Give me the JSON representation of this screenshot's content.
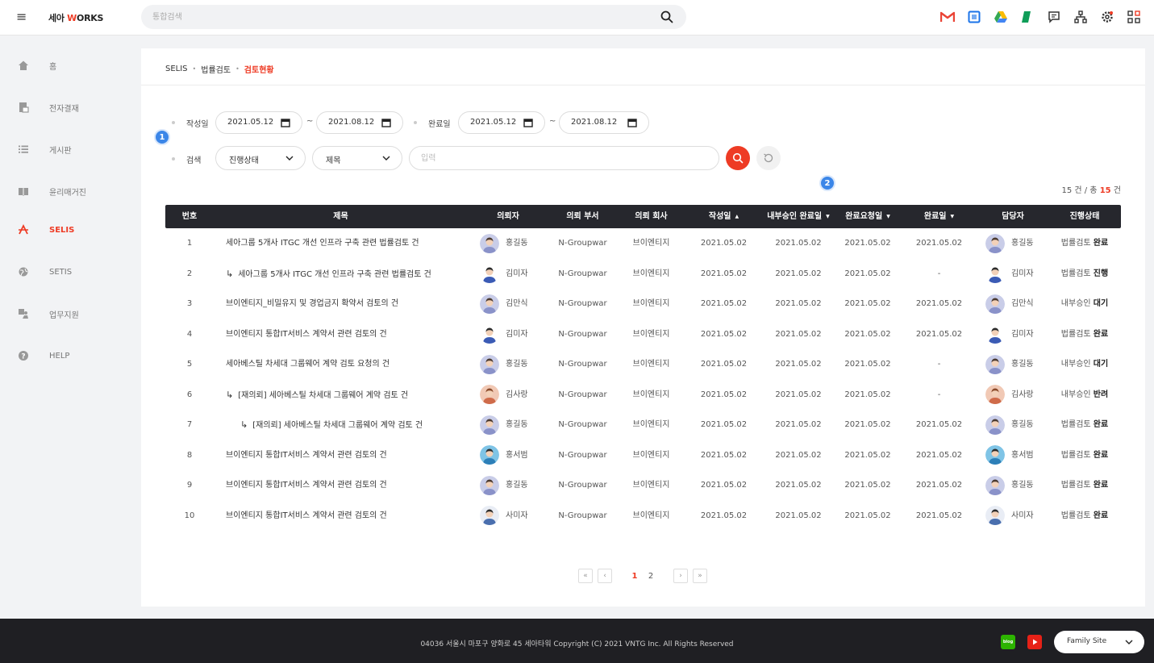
{
  "topbar": {
    "logo_prefix": "세아 ",
    "logo_w": "W",
    "logo_suffix": "ORKS",
    "search_placeholder": "통합검색",
    "apps": [
      {
        "icon": "gmail-icon",
        "color": "#ea4335"
      },
      {
        "icon": "calendar-icon",
        "color": "#1a73e8"
      },
      {
        "icon": "drive-icon",
        "color": "#34a853"
      },
      {
        "icon": "sheets-icon",
        "color": "#0f9d58"
      },
      {
        "icon": "chat-icon",
        "color": "#333333"
      },
      {
        "icon": "org-chart-icon",
        "color": "#333333"
      },
      {
        "icon": "settings-icon",
        "color": "#333333"
      },
      {
        "icon": "apps-grid-icon",
        "color": "#333333"
      }
    ]
  },
  "sidebar": {
    "items": [
      {
        "label": "홈",
        "icon": "home-icon",
        "active": false
      },
      {
        "label": "전자결재",
        "icon": "approval-icon",
        "active": false
      },
      {
        "label": "게시판",
        "icon": "board-icon",
        "active": false
      },
      {
        "label": "윤리매거진",
        "icon": "magazine-icon",
        "active": false
      },
      {
        "label": "SELIS",
        "icon": "selis-icon",
        "active": true
      },
      {
        "label": "SETIS",
        "icon": "globe-icon",
        "active": false
      },
      {
        "label": "업무지원",
        "icon": "support-icon",
        "active": false
      },
      {
        "label": "HELP",
        "icon": "help-icon",
        "active": false
      }
    ]
  },
  "breadcrumb": {
    "items": [
      "SELIS",
      "법률검토"
    ],
    "current": "검토현황",
    "separator": "•"
  },
  "filters": {
    "created_label": "작성일",
    "created_from": "2021.05.12",
    "created_to": "2021.08.12",
    "tilde": "~",
    "completed_label": "완료일",
    "completed_from": "2021.05.12",
    "completed_to": "2021.08.12",
    "search_label": "검색",
    "status_select": "진행상태",
    "field_select": "제목",
    "input_placeholder": "입력",
    "badge1": "1",
    "badge2": "2"
  },
  "count": {
    "shown": "15 건",
    "sep": " / 총 ",
    "total": "15",
    "unit": " 건"
  },
  "table": {
    "columns": [
      "번호",
      "제목",
      "의뢰자",
      "의뢰 부서",
      "의뢰 회사",
      "작성일",
      "내부승인 완료일",
      "완료요청일",
      "완료일",
      "담당자",
      "진행상태"
    ],
    "sort_up": "▲",
    "sort_down": "▼",
    "reply_icon": "↳",
    "rows": [
      {
        "no": "1",
        "title": "세아그룹 5개사 ITGC 개선 인프라 구축 관련 법률검토 건",
        "indent": 0,
        "requester": "홍길동",
        "avatar": "male",
        "dept": "N-Groupwar",
        "company": "브이엔티지",
        "created": "2021.05.02",
        "approved": "2021.05.02",
        "requested": "2021.05.02",
        "completed": "2021.05.02",
        "manager": "홍길동",
        "status_prefix": "법률검토 ",
        "status": "완료"
      },
      {
        "no": "2",
        "title": "세아그룹 5개사 ITGC 개선 인프라 구축 관련 법률검토 건",
        "indent": 1,
        "requester": "김미자",
        "avatar": "female",
        "dept": "N-Groupwar",
        "company": "브이엔티지",
        "created": "2021.05.02",
        "approved": "2021.05.02",
        "requested": "2021.05.02",
        "completed": "-",
        "manager": "김미자",
        "status_prefix": "법률검토 ",
        "status": "진행"
      },
      {
        "no": "3",
        "title": "브이엔티지_비밀유지 및 경업금지 확약서 검토의 건",
        "indent": 0,
        "requester": "김만식",
        "avatar": "male",
        "dept": "N-Groupwar",
        "company": "브이엔티지",
        "created": "2021.05.02",
        "approved": "2021.05.02",
        "requested": "2021.05.02",
        "completed": "2021.05.02",
        "manager": "김만식",
        "status_prefix": "내부승인 ",
        "status": "대기"
      },
      {
        "no": "4",
        "title": "브이엔티지 통합IT서비스 계약서 관련 검토의 건",
        "indent": 0,
        "requester": "김미자",
        "avatar": "female",
        "dept": "N-Groupwar",
        "company": "브이엔티지",
        "created": "2021.05.02",
        "approved": "2021.05.02",
        "requested": "2021.05.02",
        "completed": "2021.05.02",
        "manager": "김미자",
        "status_prefix": "법률검토 ",
        "status": "완료"
      },
      {
        "no": "5",
        "title": "세아베스틸 차세대 그룹웨어 계약 검토 요청의 건",
        "indent": 0,
        "requester": "홍길동",
        "avatar": "male",
        "dept": "N-Groupwar",
        "company": "브이엔티지",
        "created": "2021.05.02",
        "approved": "2021.05.02",
        "requested": "2021.05.02",
        "completed": "-",
        "manager": "홍길동",
        "status_prefix": "내부승인 ",
        "status": "대기"
      },
      {
        "no": "6",
        "title": "[재의뢰] 세아베스틸 차세대 그룹웨어 계약 검토 건",
        "indent": 1,
        "requester": "김사랑",
        "avatar": "female2",
        "dept": "N-Groupwar",
        "company": "브이엔티지",
        "created": "2021.05.02",
        "approved": "2021.05.02",
        "requested": "2021.05.02",
        "completed": "-",
        "manager": "김사랑",
        "status_prefix": "내부승인 ",
        "status": "반려"
      },
      {
        "no": "7",
        "title": "[재의뢰] 세아베스틸 차세대 그룹웨어 계약 검토 건",
        "indent": 2,
        "requester": "홍길동",
        "avatar": "male",
        "dept": "N-Groupwar",
        "company": "브이엔티지",
        "created": "2021.05.02",
        "approved": "2021.05.02",
        "requested": "2021.05.02",
        "completed": "2021.05.02",
        "manager": "홍길동",
        "status_prefix": "법률검토 ",
        "status": "완료"
      },
      {
        "no": "8",
        "title": "브이엔티지 통합IT서비스 계약서 관련 검토의 건",
        "indent": 0,
        "requester": "홍서범",
        "avatar": "male2",
        "dept": "N-Groupwar",
        "company": "브이엔티지",
        "created": "2021.05.02",
        "approved": "2021.05.02",
        "requested": "2021.05.02",
        "completed": "2021.05.02",
        "manager": "홍서범",
        "status_prefix": "법률검토 ",
        "status": "완료"
      },
      {
        "no": "9",
        "title": "브이엔티지 통합IT서비스 계약서 관련 검토의 건",
        "indent": 0,
        "requester": "홍길동",
        "avatar": "male",
        "dept": "N-Groupwar",
        "company": "브이엔티지",
        "created": "2021.05.02",
        "approved": "2021.05.02",
        "requested": "2021.05.02",
        "completed": "2021.05.02",
        "manager": "홍길동",
        "status_prefix": "법률검토 ",
        "status": "완료"
      },
      {
        "no": "10",
        "title": "브이엔티지 통합IT서비스 계약서 관련 검토의 건",
        "indent": 0,
        "requester": "사미자",
        "avatar": "male3",
        "dept": "N-Groupwar",
        "company": "브이엔티지",
        "created": "2021.05.02",
        "approved": "2021.05.02",
        "requested": "2021.05.02",
        "completed": "2021.05.02",
        "manager": "사미자",
        "status_prefix": "법률검토 ",
        "status": "완료"
      }
    ]
  },
  "pager": {
    "first": "«",
    "prev": "‹",
    "pages": [
      "1",
      "2"
    ],
    "current": "1",
    "next": "›",
    "last": "»"
  },
  "footer": {
    "copyright": "04036 서울시 마포구 양화로 45 세아타워 Copyright (C) 2021 VNTG Inc. All Rights Reserved",
    "family_site": "Family Site",
    "blog_label": "blog"
  },
  "colors": {
    "accent": "#ee3b24",
    "header_bg": "#26272d",
    "badge": "#3b86e8"
  }
}
